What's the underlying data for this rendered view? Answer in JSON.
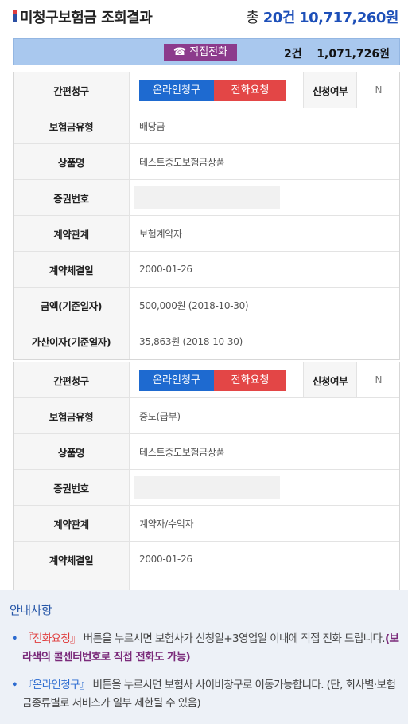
{
  "header": {
    "title": "미청구보험금 조회결과",
    "total_prefix": "총",
    "total_count": "20건",
    "total_amount": "10,717,260원"
  },
  "summary": {
    "call_button": "☎ 직접전화",
    "count": "2건",
    "amount": "1,071,726원"
  },
  "cards": [
    {
      "easy_claim_label": "간편청구",
      "online_button": "온라인청구",
      "call_button": "전화요청",
      "apply_label": "신청여부",
      "apply_value": "N",
      "rows": [
        {
          "label": "보험금유형",
          "value": "배당금"
        },
        {
          "label": "상품명",
          "value": "테스트중도보험금상품"
        },
        {
          "label": "증권번호",
          "value": ""
        },
        {
          "label": "계약관계",
          "value": "보험계약자"
        },
        {
          "label": "계약체결일",
          "value": "2000-01-26"
        },
        {
          "label": "금액(기준일자)",
          "value": "500,000원 (2018-10-30)"
        },
        {
          "label": "가산이자(기준일자)",
          "value": "35,863원 (2018-10-30)"
        }
      ]
    },
    {
      "easy_claim_label": "간편청구",
      "online_button": "온라인청구",
      "call_button": "전화요청",
      "apply_label": "신청여부",
      "apply_value": "N",
      "rows": [
        {
          "label": "보험금유형",
          "value": "중도(급부)"
        },
        {
          "label": "상품명",
          "value": "테스트중도보험금상품"
        },
        {
          "label": "증권번호",
          "value": ""
        },
        {
          "label": "계약관계",
          "value": "계약자/수익자"
        },
        {
          "label": "계약체결일",
          "value": "2000-01-26"
        }
      ]
    }
  ],
  "notice": {
    "title": "안내사항",
    "item1": {
      "bullet": "•",
      "highlight": "『전화요청』",
      "text": " 버튼을 누르시면 보험사가 신청일+3영업일 이내에 직접 전화 드립니다.",
      "emphasis": "(보라색의 콜센터번호로 직접 전화도 가능)"
    },
    "item2": {
      "bullet": "•",
      "highlight": "『온라인청구』",
      "text": " 버튼을 누르시면 보험사 사이버창구로 이동가능합니다. (단, 회사별·보험금종류별로 서비스가 일부 제한될 수 있음)"
    }
  },
  "colors": {
    "accent_blue": "#1d4fb8",
    "online_button": "#1e6ad0",
    "call_button": "#e34646",
    "direct_call": "#8c3b8c",
    "summary_bg": "#a9c8ee"
  }
}
